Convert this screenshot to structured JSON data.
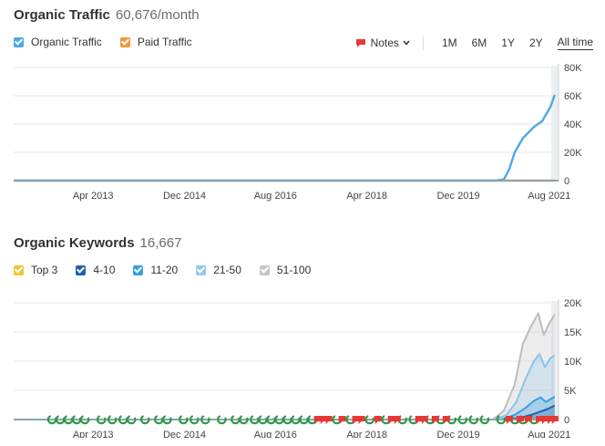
{
  "traffic": {
    "title": "Organic Traffic",
    "metric": "60,676/month",
    "legend": [
      {
        "label": "Organic Traffic",
        "color": "#4ea8e8"
      },
      {
        "label": "Paid Traffic",
        "color": "#f2973a"
      }
    ],
    "notes_label": "Notes",
    "ranges": [
      "1M",
      "6M",
      "1Y",
      "2Y",
      "All time"
    ],
    "active_range": "All time"
  },
  "keywords": {
    "title": "Organic Keywords",
    "metric": "16,667",
    "legend": [
      {
        "label": "Top 3",
        "color": "#f6c433"
      },
      {
        "label": "4-10",
        "color": "#1f62a8"
      },
      {
        "label": "11-20",
        "color": "#3a9de0"
      },
      {
        "label": "21-50",
        "color": "#94c9ee"
      },
      {
        "label": "51-100",
        "color": "#c6c6c6"
      }
    ]
  },
  "colors": {
    "organic": "#4ea8e8",
    "paid": "#f2973a",
    "grid": "#e6e6e6",
    "google_marker": "#2e9a45",
    "note_marker": "#e53935"
  },
  "chart_data": [
    {
      "type": "line",
      "x_ticks": [
        "Apr 2013",
        "Dec 2014",
        "Aug 2016",
        "Apr 2018",
        "Dec 2019",
        "Aug 2021"
      ],
      "y_ticks": [
        "0",
        "20K",
        "40K",
        "60K",
        "80K"
      ],
      "ylim": [
        0,
        80000
      ],
      "x_range": [
        2011.8,
        2021.75
      ],
      "series": [
        {
          "name": "Organic Traffic",
          "points": [
            [
              2011.8,
              0
            ],
            [
              2020.6,
              0
            ],
            [
              2020.75,
              800
            ],
            [
              2020.85,
              8000
            ],
            [
              2020.95,
              20000
            ],
            [
              2021.1,
              30000
            ],
            [
              2021.3,
              38000
            ],
            [
              2021.45,
              42000
            ],
            [
              2021.6,
              52000
            ],
            [
              2021.68,
              60676
            ]
          ]
        },
        {
          "name": "Paid Traffic",
          "points": [
            [
              2011.8,
              0
            ],
            [
              2021.68,
              0
            ]
          ]
        }
      ]
    },
    {
      "type": "area",
      "x_ticks": [
        "Apr 2013",
        "Dec 2014",
        "Aug 2016",
        "Apr 2018",
        "Dec 2019",
        "Aug 2021"
      ],
      "y_ticks": [
        "0",
        "5K",
        "10K",
        "15K",
        "20K"
      ],
      "ylim": [
        0,
        20000
      ],
      "x_range": [
        2011.8,
        2021.75
      ],
      "series": [
        {
          "name": "51-100",
          "points": [
            [
              2011.8,
              0
            ],
            [
              2020.55,
              0
            ],
            [
              2020.75,
              1500
            ],
            [
              2020.95,
              6000
            ],
            [
              2021.1,
              13000
            ],
            [
              2021.25,
              16000
            ],
            [
              2021.38,
              18200
            ],
            [
              2021.48,
              14500
            ],
            [
              2021.58,
              16500
            ],
            [
              2021.68,
              18000
            ]
          ]
        },
        {
          "name": "21-50",
          "points": [
            [
              2011.8,
              0
            ],
            [
              2020.6,
              0
            ],
            [
              2020.8,
              800
            ],
            [
              2020.98,
              3000
            ],
            [
              2021.15,
              7000
            ],
            [
              2021.3,
              10000
            ],
            [
              2021.4,
              11200
            ],
            [
              2021.5,
              9000
            ],
            [
              2021.6,
              10500
            ],
            [
              2021.68,
              11000
            ]
          ]
        },
        {
          "name": "11-20",
          "points": [
            [
              2011.8,
              0
            ],
            [
              2020.7,
              0
            ],
            [
              2020.95,
              800
            ],
            [
              2021.15,
              2000
            ],
            [
              2021.3,
              3200
            ],
            [
              2021.42,
              3800
            ],
            [
              2021.52,
              3000
            ],
            [
              2021.62,
              3600
            ],
            [
              2021.68,
              3900
            ]
          ]
        },
        {
          "name": "4-10",
          "points": [
            [
              2011.8,
              0
            ],
            [
              2020.8,
              0
            ],
            [
              2021.05,
              300
            ],
            [
              2021.25,
              800
            ],
            [
              2021.4,
              1300
            ],
            [
              2021.55,
              1800
            ],
            [
              2021.68,
              2400
            ]
          ]
        },
        {
          "name": "Top 3",
          "points": [
            [
              2011.8,
              0
            ],
            [
              2021.68,
              0
            ]
          ]
        }
      ],
      "markers": {
        "google": [
          2012.5,
          2012.65,
          2012.8,
          2012.95,
          2013.1,
          2013.4,
          2013.6,
          2013.8,
          2013.95,
          2014.2,
          2014.45,
          2014.6,
          2014.9,
          2015.1,
          2015.3,
          2015.6,
          2015.85,
          2016.0,
          2016.2,
          2016.35,
          2016.5,
          2016.65,
          2016.8,
          2016.95,
          2017.1,
          2017.25,
          2017.7,
          2017.95,
          2018.3,
          2018.6,
          2018.9,
          2019.1,
          2019.4,
          2019.6,
          2019.8,
          2020.0,
          2020.2,
          2020.4,
          2020.7,
          2020.95,
          2021.1,
          2021.3
        ],
        "notes": [
          2017.35,
          2017.45,
          2017.55,
          2017.8,
          2018.05,
          2018.15,
          2018.45,
          2018.7,
          2018.8,
          2019.2,
          2019.3,
          2019.5,
          2019.7,
          2020.85,
          2021.05,
          2021.2,
          2021.4,
          2021.5,
          2021.6,
          2021.68
        ]
      }
    }
  ]
}
